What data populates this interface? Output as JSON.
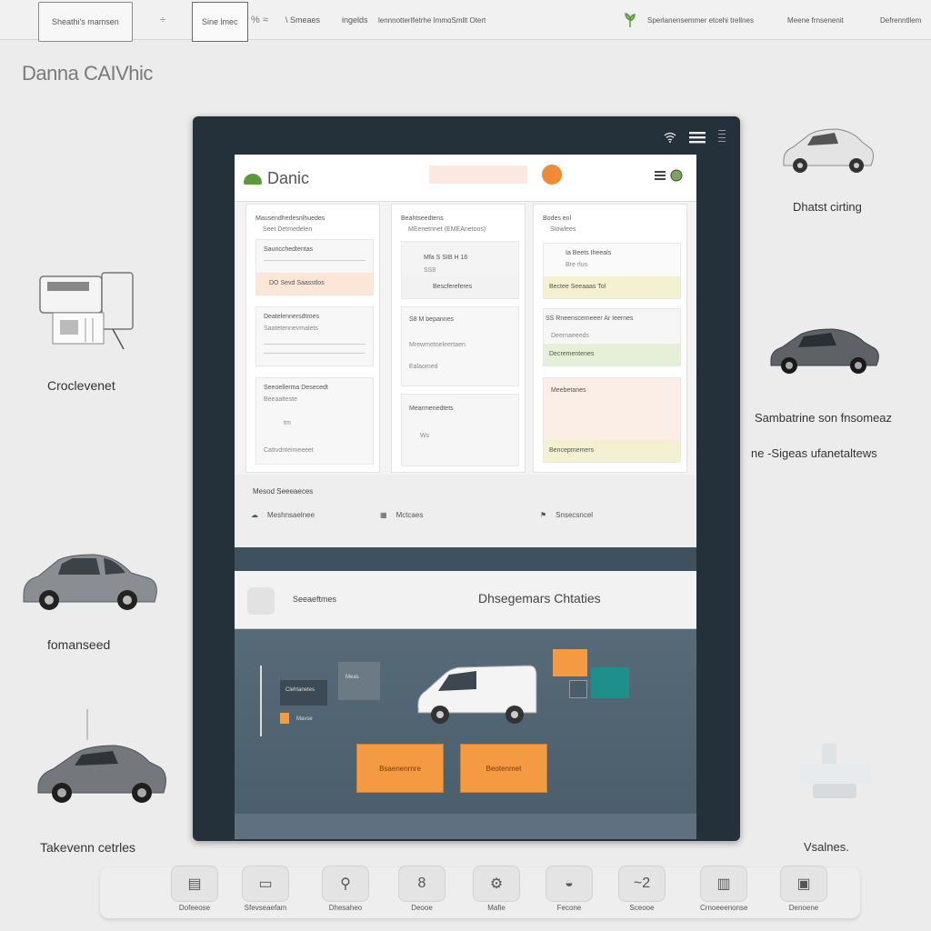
{
  "topbar": {
    "box1": "Sheathi's mamsen",
    "sym1": "÷",
    "box2": "Sine lmec",
    "sym2": "% ≈",
    "item1": "\\ Smeaes",
    "item2": "ingelds",
    "item3": "lennnotterIfetrhe ImmoSmllt Otert",
    "item4": "Sperlanensemmer etcehi trellnes",
    "item5": "Meene frnsenenit",
    "item6": "Defrenntllem"
  },
  "brand": "Danna CAIVhic",
  "side": {
    "left1": "Croclevenet",
    "left2": "fomanseed",
    "left3": "Takevenn  cetrles",
    "right1": "Dhatst cirting",
    "right2": "Sambatrine son fnsomeaz",
    "right3": "ne -Sigeas ufanetaltews",
    "right4": "Vsalnes."
  },
  "device": {
    "icons": [
      "wifi-icon",
      "menu-icon",
      "more-icon"
    ],
    "app_name": "Danic",
    "search_placeholder": "",
    "col1": {
      "header": "Mausendhedesnlhuedes",
      "sub": "Seet Detmedelen",
      "b1_t": "Sauncchedtentas",
      "b1_f": "DO Sevd Saasstlos",
      "b2_t": "Deatelennersdtroes",
      "b2_t2": "Saatetennevmalets",
      "b3_t": "Seeoellerma Desecedt",
      "b3_t2": "Beeaalteste",
      "b3_t3": "tm",
      "b3_t4": "Cattvdnteimeeeet"
    },
    "col2": {
      "header": "Beahtseedtens",
      "sub": "MEenetnnet (EMEAnetoos)",
      "b1_t": "Mfa S SIB H 16",
      "b1_t2": "SS8",
      "b1_f": "Bescfereferes",
      "b2_t": "S8 M bepannes",
      "b2_t2": "Mrewmetneleertaen",
      "b2_t3": "Ealaomed",
      "b3_t": "Mearmenedtets",
      "b3_t2": "Ws"
    },
    "col3": {
      "header": "Bodes enl",
      "sub": "Stowlees",
      "b1_t": "Ia Beets Iheeals",
      "b1_t2": "Bre rlus",
      "b1_f": "Bectee Seeaaas Tol",
      "b2_t": "SS Rneenscemeeer Ar Ieernes",
      "b2_t2": "Deernaeeeds",
      "b2_f": "Decrementenes",
      "b3_t": "Meebetanes",
      "b3_f": "Bencepmemers"
    },
    "mid": {
      "title": "Mesod Seeeaeces",
      "item1": "Meshnsaelnee",
      "item2": "Mctcaes",
      "item3": "Snsecsncel"
    },
    "bar2": {
      "left": "Seeaeftmes",
      "right": "Dhsegemars  Chtaties"
    },
    "canvas": {
      "mini1": "Clehtanetes",
      "mini2": "Meas",
      "mini3": "Mavse",
      "btn1": "Bsaenenrnre",
      "btn2": "Beotenmet"
    }
  },
  "dock": [
    {
      "icon": "▤",
      "name": "printer",
      "label": "Dofeeose"
    },
    {
      "icon": "▭",
      "name": "display",
      "label": "Sfevseaefam"
    },
    {
      "icon": "⚲",
      "name": "tools",
      "label": "Dhesaheo"
    },
    {
      "icon": "8",
      "name": "eight",
      "label": "Deooe"
    },
    {
      "icon": "⚙",
      "name": "gear",
      "label": "Mafie"
    },
    {
      "icon": "◒",
      "name": "gauge",
      "label": "Fecone"
    },
    {
      "icon": "~2",
      "name": "chart",
      "label": "Sceooe"
    },
    {
      "icon": "▥",
      "name": "battery",
      "label": "Crnoeeenonse"
    },
    {
      "icon": "▣",
      "name": "device",
      "label": "Denoene"
    }
  ]
}
